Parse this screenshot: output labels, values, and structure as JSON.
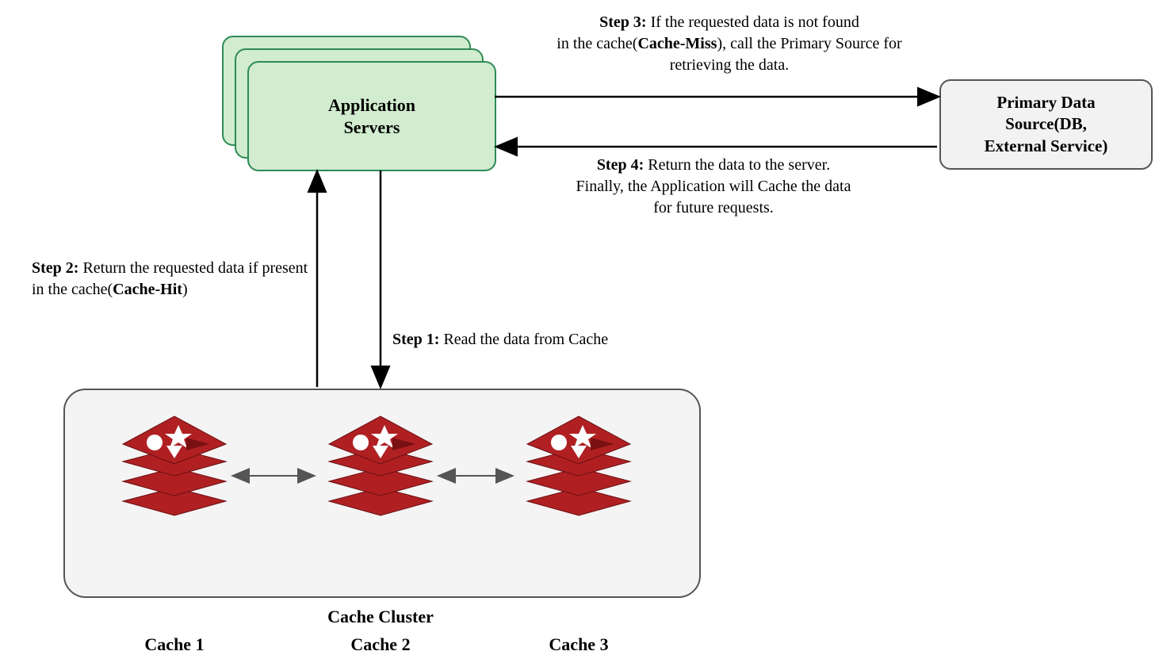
{
  "app_servers": {
    "label": "Application\nServers"
  },
  "primary_source": {
    "label": "Primary Data\nSource(DB,\nExternal Service)"
  },
  "cache_cluster": {
    "title": "Cache Cluster"
  },
  "caches": [
    {
      "label": "Cache 1"
    },
    {
      "label": "Cache 2"
    },
    {
      "label": "Cache 3"
    }
  ],
  "steps": {
    "s1": {
      "bold": "Step 1:",
      "text": " Read the data from Cache"
    },
    "s2": {
      "bold1": "Step 2:",
      "text1": " Return the requested data if present in the cache(",
      "bold2": "Cache-Hit",
      "text2": ")"
    },
    "s3": {
      "bold1": "Step 3:",
      "text1": " If the requested data is not found\nin the cache(",
      "bold2": "Cache-Miss",
      "text2": "), call the Primary Source for\nretrieving the data."
    },
    "s4": {
      "bold": "Step 4:",
      "text": " Return the data to the server.\nFinally, the Application will Cache the data\nfor future requests."
    }
  },
  "colors": {
    "server_fill": "#d1ecce",
    "server_stroke": "#2e8b57",
    "box_fill": "#f3f2f2",
    "redis": "#b02023"
  }
}
